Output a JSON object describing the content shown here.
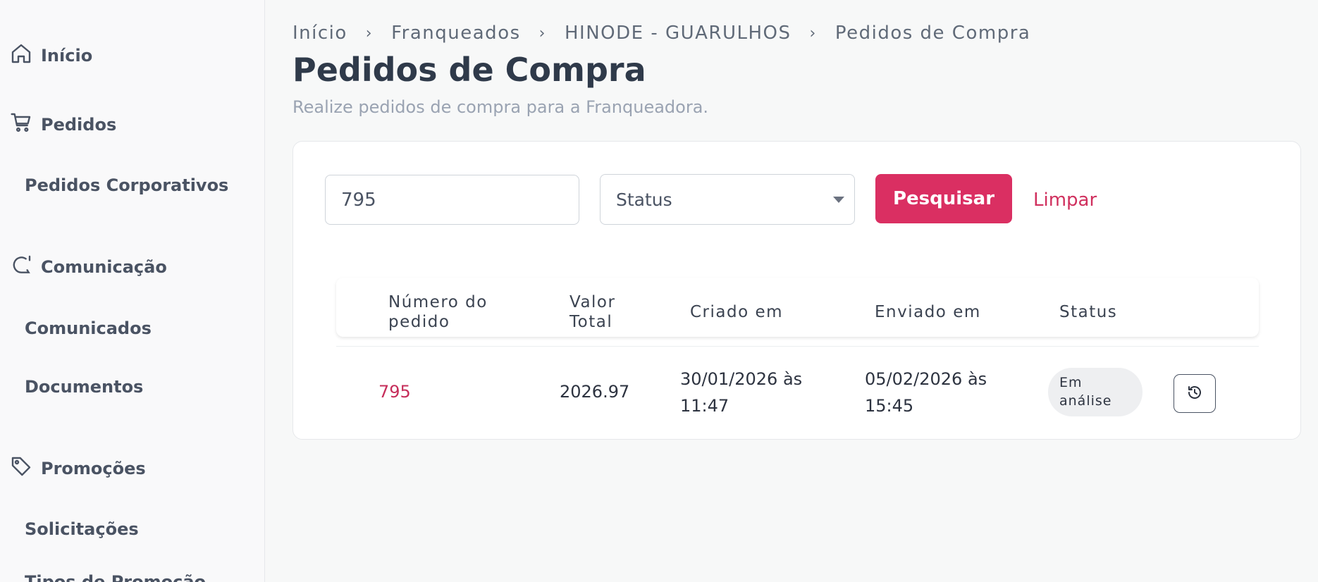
{
  "sidebar": {
    "groups": [
      {
        "label": "Início",
        "icon": "home-icon"
      },
      {
        "label": "Pedidos",
        "icon": "cart-icon"
      },
      {
        "label": "Comunicação",
        "icon": "chat-icon"
      },
      {
        "label": "Promoções",
        "icon": "tag-icon"
      }
    ],
    "subitems": {
      "pedidos_corporativos": "Pedidos Corporativos",
      "comunicados": "Comunicados",
      "documentos": "Documentos",
      "solicitacoes": "Solicitações",
      "tipos_promocao": "Tipos de Promoção"
    }
  },
  "breadcrumb": [
    "Início",
    "Franqueados",
    "HINODE - GUARULHOS",
    "Pedidos de Compra"
  ],
  "breadcrumb_separator": "›",
  "page": {
    "title": "Pedidos de Compra",
    "subtitle": "Realize pedidos de compra para a Franqueadora."
  },
  "filters": {
    "search_value": "795",
    "status_placeholder": "Status",
    "search_button": "Pesquisar",
    "clear_button": "Limpar"
  },
  "table": {
    "headers": {
      "numero_line1": "Número do",
      "numero_line2": "pedido",
      "valor_line1": "Valor",
      "valor_line2": "Total",
      "criado": "Criado em",
      "enviado": "Enviado em",
      "status": "Status"
    },
    "rows": [
      {
        "numero": "795",
        "valor": "2026.97",
        "criado_line1": "30/01/2026 às",
        "criado_line2": "11:47",
        "enviado_line1": "05/02/2026 às",
        "enviado_line2": "15:45",
        "status_line1": "Em",
        "status_line2": "análise"
      }
    ]
  },
  "colors": {
    "accent": "#da2f62",
    "link": "#c62d5a"
  }
}
